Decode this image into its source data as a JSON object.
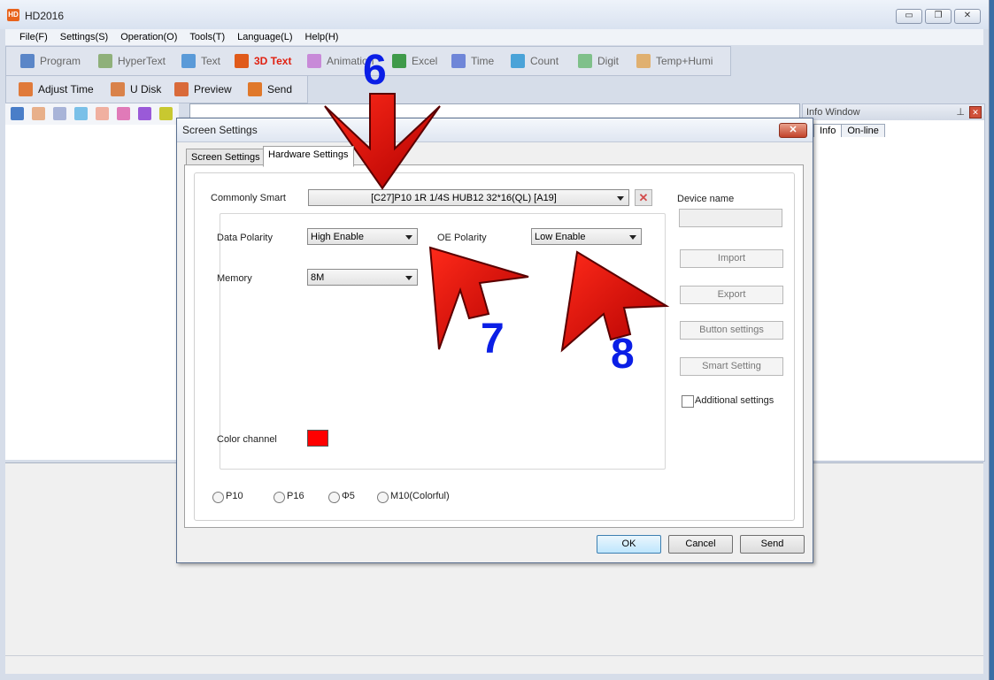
{
  "app": {
    "title": "HD2016",
    "icon_text": "HD"
  },
  "window_buttons": {
    "minimize": "▭",
    "maximize": "❐",
    "close": "✕"
  },
  "menu": [
    "File(F)",
    "Settings(S)",
    "Operation(O)",
    "Tools(T)",
    "Language(L)",
    "Help(H)"
  ],
  "toolbar1": [
    {
      "label": "Program",
      "icon": "program-icon",
      "color": "#5a86c8"
    },
    {
      "label": "HyperText",
      "icon": "hypertext-icon",
      "color": "#8fb07a"
    },
    {
      "label": "Text",
      "icon": "text-icon",
      "color": "#5a9ad8"
    },
    {
      "label": "3D Text",
      "icon": "3d-text-icon",
      "color": "#e05a1a"
    },
    {
      "label": "Animation",
      "icon": "animation-icon",
      "color": "#c88ad8"
    },
    {
      "label": "Excel",
      "icon": "excel-icon",
      "color": "#3f9a4a"
    },
    {
      "label": "Time",
      "icon": "time-icon",
      "color": "#6f86d8"
    },
    {
      "label": "Count",
      "icon": "count-icon",
      "color": "#4aa3d8"
    },
    {
      "label": "Digit",
      "icon": "digit-icon",
      "color": "#7fc08a"
    },
    {
      "label": "Temp+Humi",
      "icon": "temp-humi-icon",
      "color": "#e0b070"
    }
  ],
  "toolbar2": [
    {
      "label": "Adjust Time",
      "icon": "adjust-time-icon",
      "color": "#e07a3a"
    },
    {
      "label": "U Disk",
      "icon": "usb-disk-icon",
      "color": "#d9824a"
    },
    {
      "label": "Preview",
      "icon": "preview-icon",
      "color": "#d96a3a"
    },
    {
      "label": "Send",
      "icon": "send-icon",
      "color": "#e0782a"
    }
  ],
  "info_panel": {
    "title": "Info Window",
    "tabs": [
      "Info",
      "On-line"
    ]
  },
  "dialog": {
    "title": "Screen Settings",
    "close": "✕",
    "tabs": [
      "Screen Settings",
      "Hardware Settings"
    ],
    "commonly_smart_label": "Commonly Smart",
    "commonly_smart_value": "[C27]P10  1R 1/4S  HUB12 32*16(QL)  [A19]",
    "clear": "✕",
    "data_polarity_label": "Data Polarity",
    "data_polarity_value": "High Enable",
    "oe_polarity_label": "OE Polarity",
    "oe_polarity_value": "Low Enable",
    "memory_label": "Memory",
    "memory_value": "8M",
    "color_channel_label": "Color channel",
    "color_channel_color": "#ff0000",
    "device_name_label": "Device name",
    "device_name_value": "",
    "side_buttons": [
      "Import",
      "Export",
      "Button settings",
      "Smart Setting"
    ],
    "additional_settings_label": "Additional settings",
    "panel_types": [
      "P10",
      "P16",
      "Φ5",
      "M10(Colorful)"
    ],
    "buttons": {
      "ok": "OK",
      "cancel": "Cancel",
      "send": "Send"
    }
  },
  "annotations": {
    "step6": "6",
    "step7": "7",
    "step8": "8",
    "arrow_color": "#c80000"
  }
}
